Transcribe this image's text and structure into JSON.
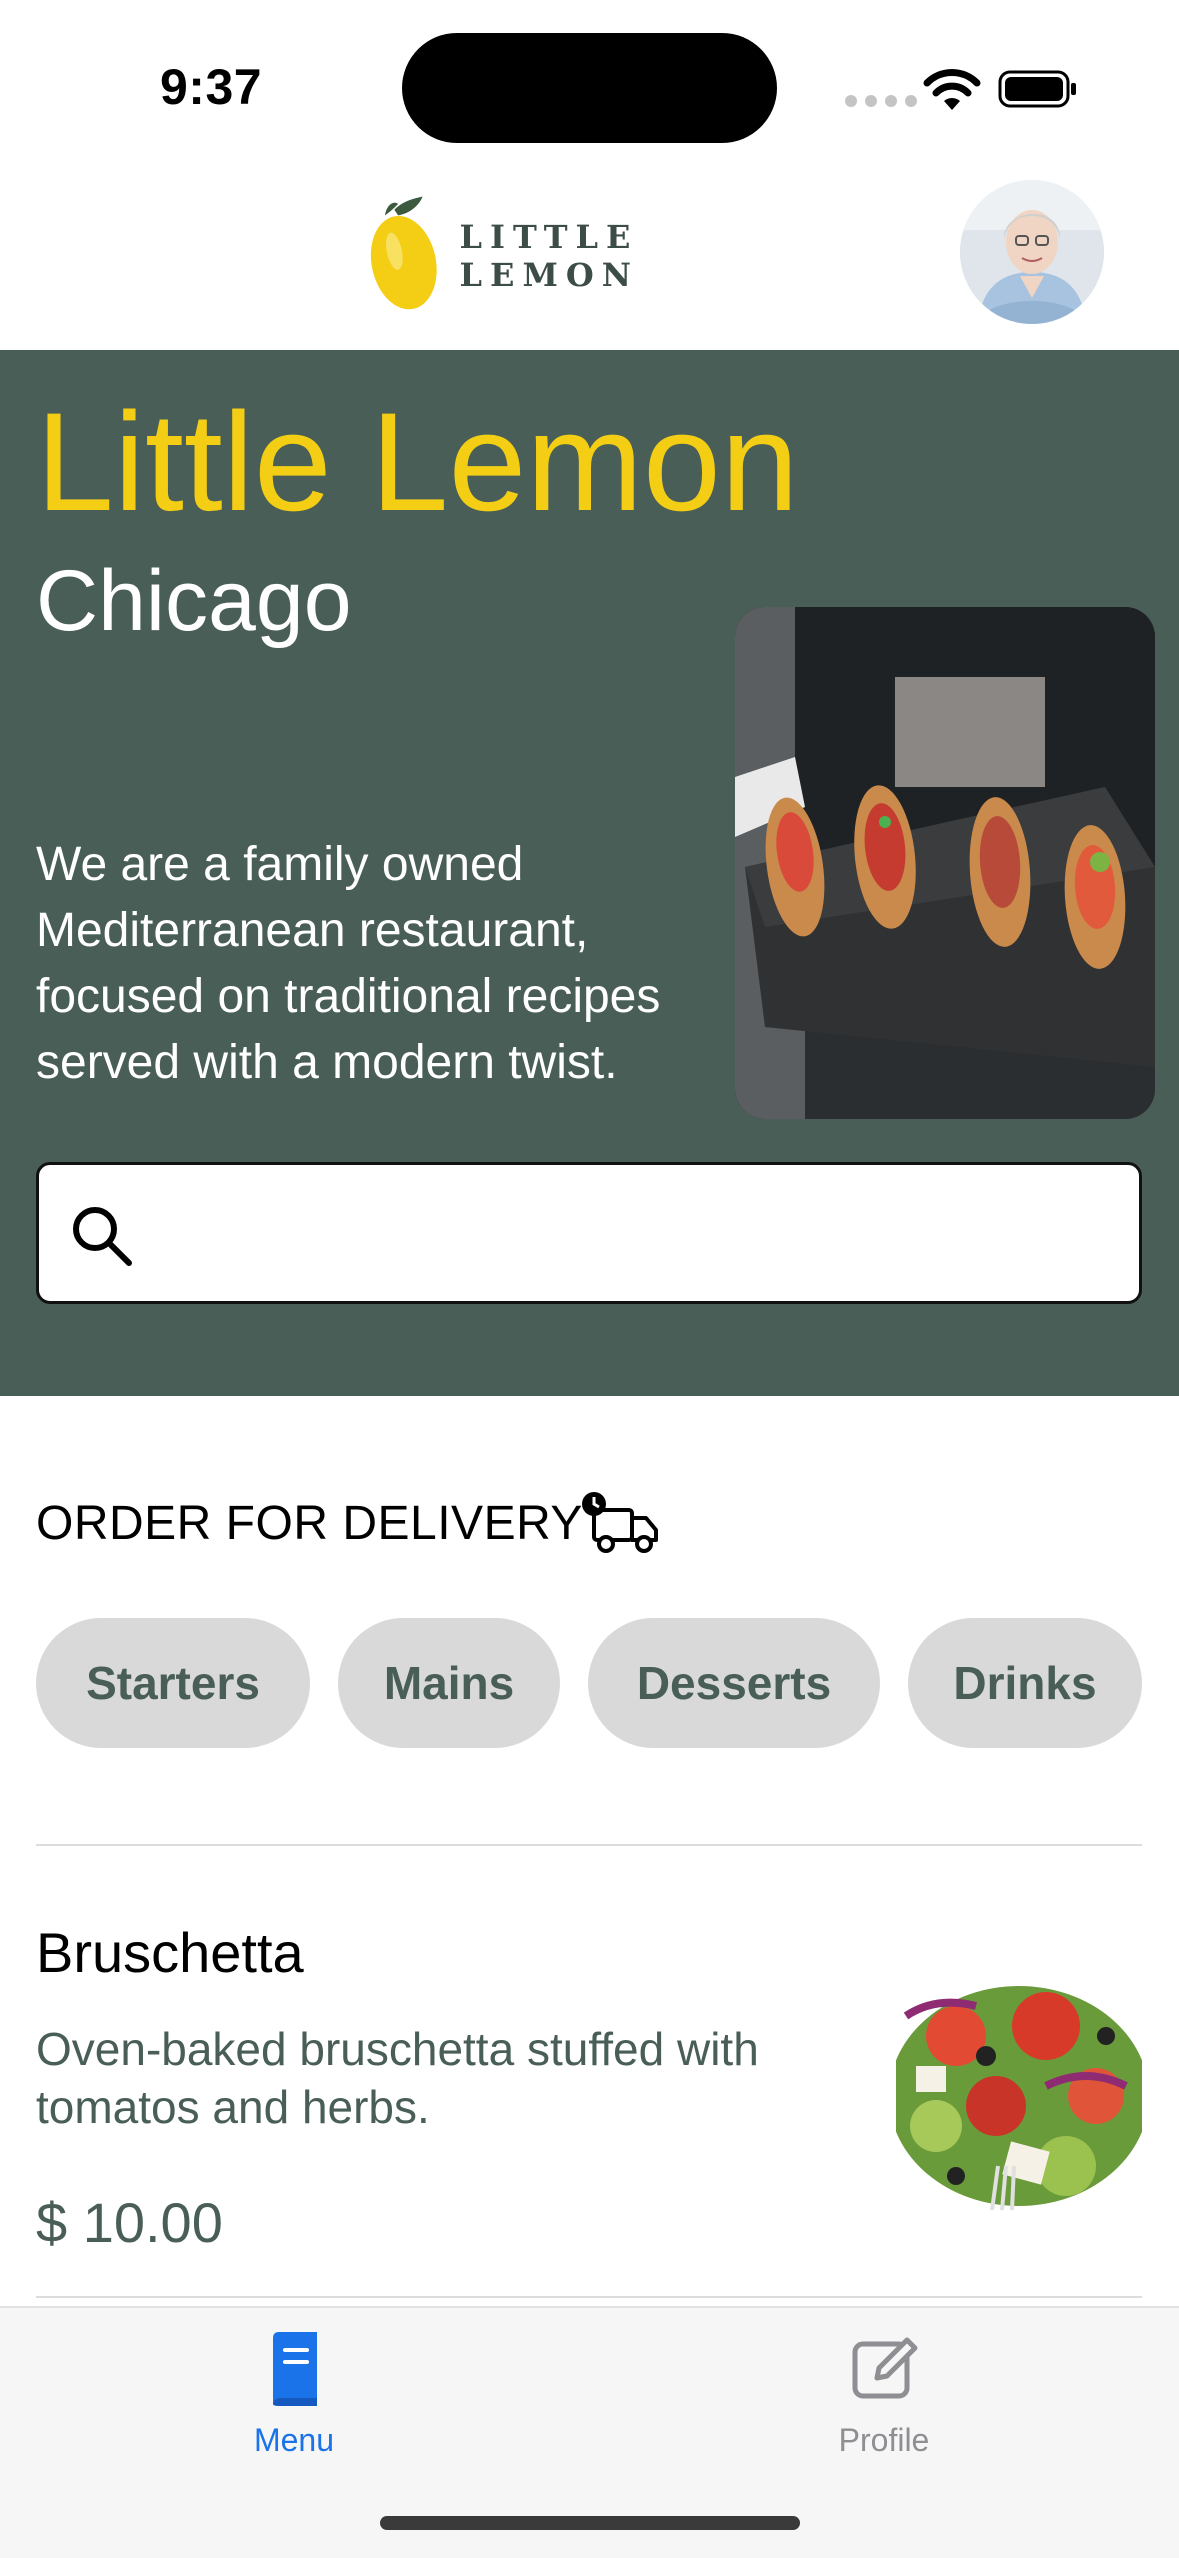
{
  "status_bar": {
    "time": "9:37"
  },
  "header": {
    "logo_text": "LITTLE LEMON"
  },
  "hero": {
    "title": "Little Lemon",
    "city": "Chicago",
    "description": "We are a family owned Mediterranean restaurant, focused on traditional recipes served with a modern twist.",
    "search": {
      "value": "",
      "placeholder": ""
    }
  },
  "delivery": {
    "title": "ORDER FOR DELIVERY",
    "categories": [
      "Starters",
      "Mains",
      "Desserts",
      "Drinks"
    ]
  },
  "menu_items": [
    {
      "name": "Bruschetta",
      "description": "Oven-baked bruschetta stuffed with tomatos and herbs.",
      "price": "$ 10.00"
    }
  ],
  "tab_bar": {
    "tabs": [
      {
        "label": "Menu",
        "icon": "book-icon",
        "active": true
      },
      {
        "label": "Profile",
        "icon": "edit-icon",
        "active": false
      }
    ]
  },
  "colors": {
    "primary_green": "#495e57",
    "primary_yellow": "#f4ce14",
    "tab_active": "#1a73e8",
    "tab_inactive": "#8e8e93"
  }
}
